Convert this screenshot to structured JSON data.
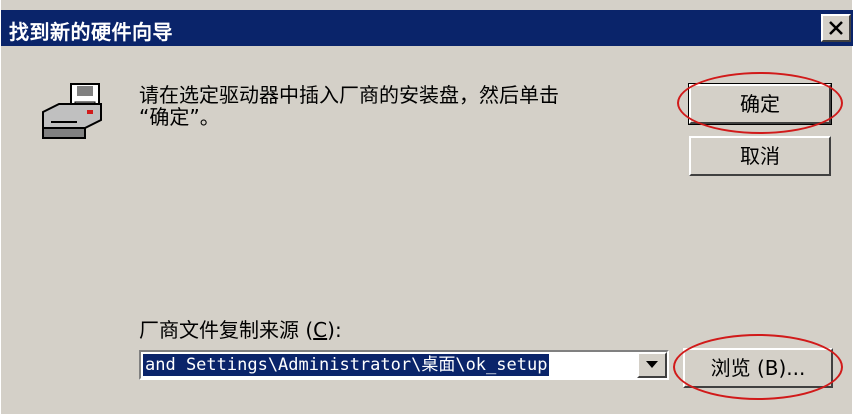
{
  "window": {
    "title": "找到新的硬件向导",
    "close_icon": "close-icon"
  },
  "message": "请在选定驱动器中插入厂商的安装盘，然后单击\n“确定”。",
  "buttons": {
    "ok_label": "确定",
    "cancel_label": "取消",
    "browse_label": "浏览",
    "browse_accel": "(B)...",
    "browse_accel_key": "B"
  },
  "source": {
    "label_text": "厂商文件复制来源",
    "label_accel": "C",
    "value": "and Settings\\Administrator\\桌面\\ok_setup"
  },
  "icons": {
    "device": "floppy-drive-icon",
    "dropdown": "chevron-down-icon"
  },
  "colors": {
    "titlebar": "#0a246a",
    "dialog": "#d4d0c8",
    "highlight": "#0a246a",
    "annotation": "#d11a1a"
  }
}
